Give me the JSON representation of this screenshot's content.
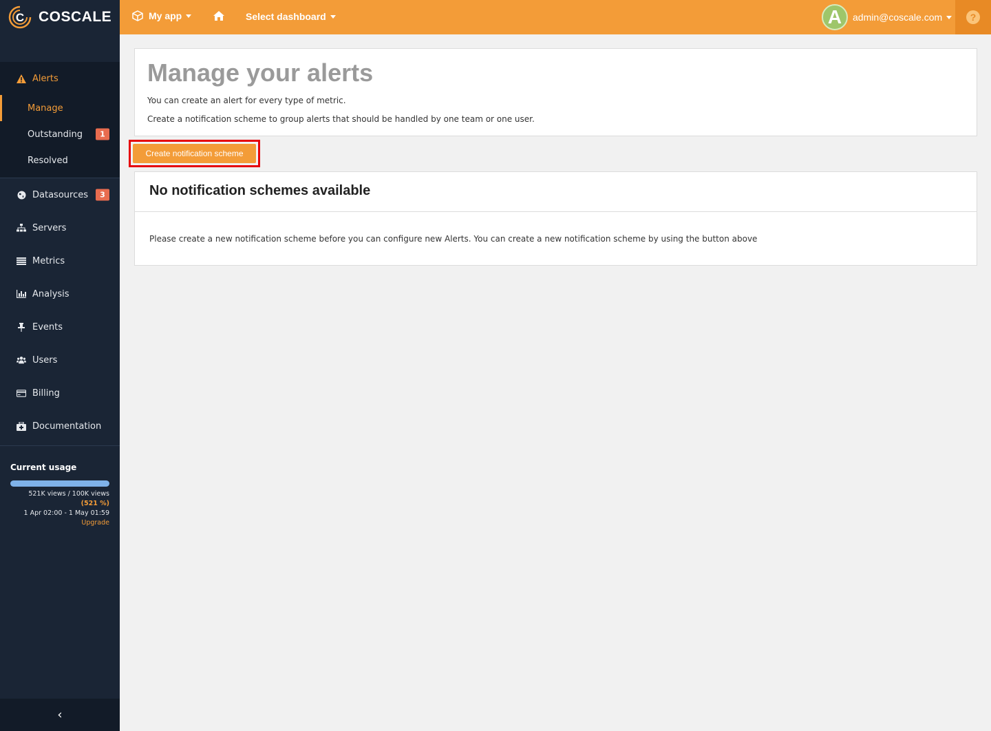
{
  "brand": {
    "name": "COSCALE",
    "accent": "#f39c38",
    "sidebar_bg": "#1a2535"
  },
  "topbar": {
    "app_label": "My app",
    "dashboard_label": "Select dashboard",
    "user_initial": "A",
    "user_email": "admin@coscale.com",
    "help_label": "?"
  },
  "sidebar": {
    "alerts": {
      "label": "Alerts",
      "icon": "warning-icon",
      "children": [
        {
          "label": "Manage",
          "active": true
        },
        {
          "label": "Outstanding",
          "badge": "1"
        },
        {
          "label": "Resolved"
        }
      ]
    },
    "items": [
      {
        "label": "Datasources",
        "icon": "globe-icon",
        "badge": "3"
      },
      {
        "label": "Servers",
        "icon": "sitemap-icon"
      },
      {
        "label": "Metrics",
        "icon": "list-icon"
      },
      {
        "label": "Analysis",
        "icon": "bar-chart-icon"
      },
      {
        "label": "Events",
        "icon": "pin-icon"
      },
      {
        "label": "Users",
        "icon": "users-icon"
      },
      {
        "label": "Billing",
        "icon": "credit-card-icon"
      },
      {
        "label": "Documentation",
        "icon": "medkit-icon"
      }
    ],
    "usage": {
      "title": "Current usage",
      "views_text": "521K views / 100K views",
      "percent_text": "(521 %)",
      "percent_value": 521,
      "period": "1 Apr 02:00 - 1 May 01:59",
      "upgrade_label": "Upgrade"
    },
    "collapse_label": "‹"
  },
  "main": {
    "title": "Manage your alerts",
    "desc1": "You can create an alert for every type of metric.",
    "desc2": "Create a notification scheme to group alerts that should be handled by one team or one user.",
    "create_button": "Create notification scheme",
    "empty_title": "No notification schemes available",
    "empty_body": "Please create a new notification scheme before you can configure new Alerts. You can create a new notification scheme by using the button above"
  }
}
